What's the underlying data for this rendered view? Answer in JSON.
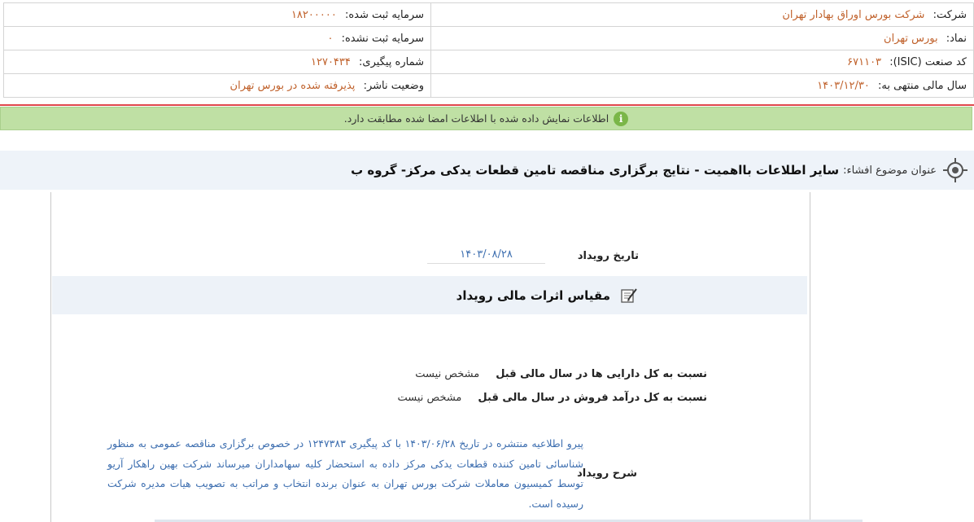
{
  "header_info": {
    "company_label": "شرکت:",
    "company_value": "شرکت بورس اوراق بهادار تهران",
    "registered_capital_label": "سرمایه ثبت شده:",
    "registered_capital_value": "۱۸۲۰۰۰۰۰",
    "symbol_label": "نماد:",
    "symbol_value": "بورس تهران",
    "unregistered_capital_label": "سرمایه ثبت نشده:",
    "unregistered_capital_value": "۰",
    "isic_label": "کد صنعت (ISIC):",
    "isic_value": "۶۷۱۱۰۳",
    "tracking_label": "شماره پیگیری:",
    "tracking_value": "۱۲۷۰۴۳۴",
    "fiscal_year_label": "سال مالی منتهی به:",
    "fiscal_year_value": "۱۴۰۳/۱۲/۳۰",
    "publisher_status_label": "وضعیت ناشر:",
    "publisher_status_value": "پذیرفته شده در بورس تهران"
  },
  "notice": {
    "text": "اطلاعات نمایش داده شده با اطلاعات امضا شده مطابقت دارد.",
    "icon": "info-icon",
    "color": "#bfe0a4"
  },
  "subject": {
    "label": "عنوان موضوع افشاء:",
    "title": "سایر اطلاعات بااهمیت - نتایج برگزاری مناقصه تامین قطعات یدکی مرکز- گروه ب"
  },
  "event": {
    "date_label": "تاریخ رویداد",
    "date_value": "۱۴۰۳/۰۸/۲۸"
  },
  "section": {
    "title": "مقیاس اثرات مالی رویداد",
    "icon": "edit-document-icon"
  },
  "ratios": [
    {
      "label": "نسبت به کل دارایی ها در سال مالی قبل",
      "value": "مشخص نیست"
    },
    {
      "label": "نسبت به کل درآمد فروش در سال مالی قبل",
      "value": "مشخص نیست"
    }
  ],
  "description": {
    "label": "شرح رویداد",
    "text": "پیرو اطلاعیه منتشره در تاریخ ۱۴۰۳/۰۶/۲۸ با کد پیگیری ۱۲۴۷۳۸۳ در خصوص برگزاری مناقصه عمومی به منظور شناسائی تامین کننده قطعات یدکی مرکز داده به استحضار کلیه سهامداران میرساند شرکت بهین راهکار آریو توسط کمیسیون معاملات شرکت بورس تهران به عنوان برنده انتخاب و مراتب به تصویب هیات مدیره شرکت رسیده است."
  }
}
